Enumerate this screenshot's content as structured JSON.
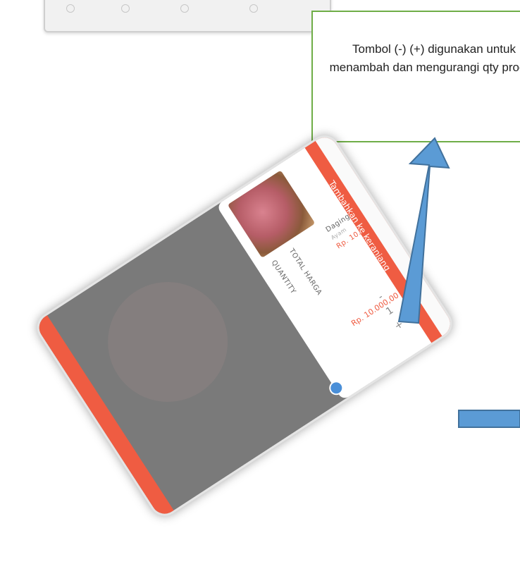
{
  "callout": {
    "text": "Tombol (-) (+) digunakan untuk menambah dan mengurangi qty produk"
  },
  "product": {
    "name": "Daging Ayam",
    "subtitle": "Ayam",
    "price": "Rp. 10.000,00"
  },
  "sheet": {
    "quantity_label": "QUANTITY",
    "total_label": "TOTAL HARGA",
    "total_value": "Rp. 10.000,00",
    "minus_label": "-",
    "qty_value": "1",
    "plus_label": "+",
    "cta_label": "Tambahkan ke keranjang"
  },
  "colors": {
    "accent": "#ef5c42",
    "callout_border": "#6fad47",
    "arrow_fill": "#5b9bd5",
    "arrow_stroke": "#41719c",
    "fab": "#4a8fd8"
  },
  "icons": [
    "arrow-up-icon",
    "arrow-right-icon",
    "close-fab-icon"
  ]
}
